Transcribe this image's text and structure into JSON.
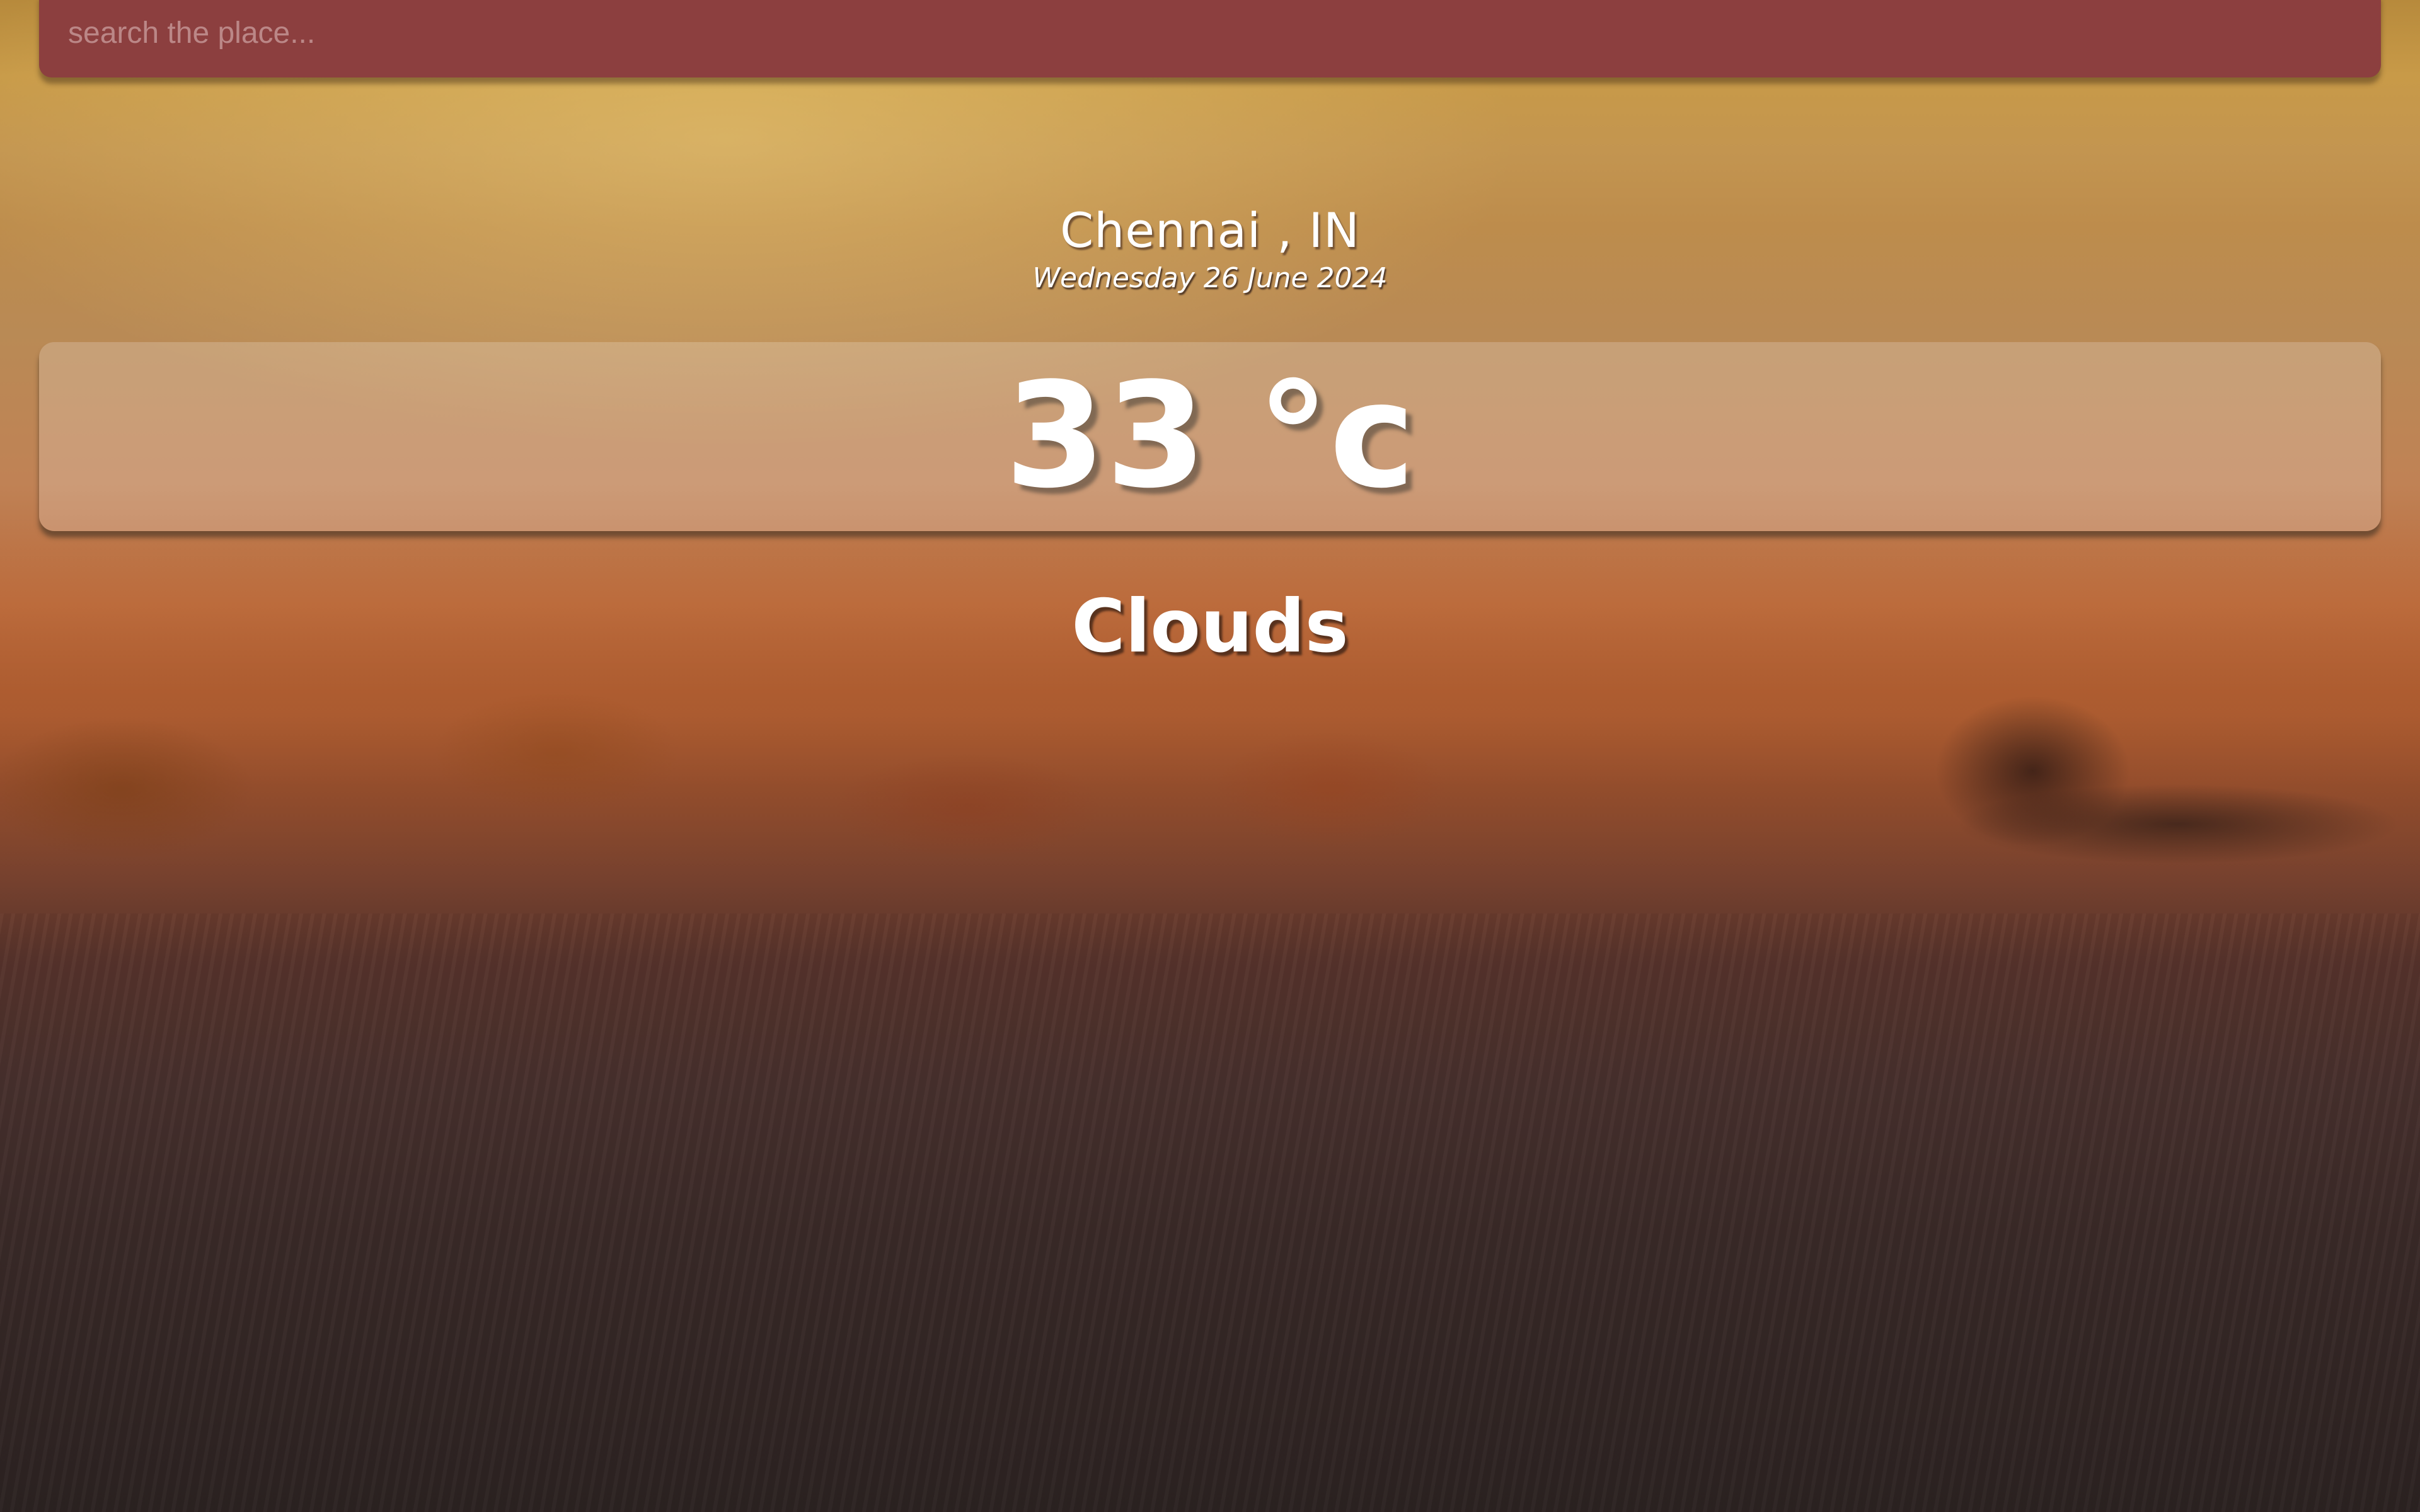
{
  "search": {
    "placeholder": "search the place...",
    "value": ""
  },
  "location": {
    "city": "Chennai , IN",
    "date": "Wednesday 26 June 2024"
  },
  "weather": {
    "temperature": "33 °c",
    "condition": "Clouds"
  },
  "colors": {
    "search_bar": "#8c3f3f",
    "text": "#ffffff"
  }
}
